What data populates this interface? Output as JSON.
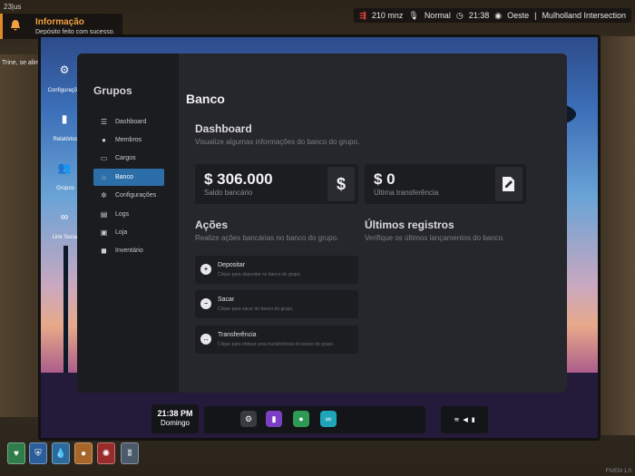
{
  "hud": {
    "player_id": "23|us",
    "notification": {
      "title": "Informação",
      "message": "Depósito feito com sucesso."
    },
    "side_text": "Trine, se alimente",
    "status_bar": {
      "money": "210 mnz",
      "mode": "Normal",
      "time": "21:38",
      "direction": "Oeste",
      "location": "Mulholland Intersection"
    },
    "watermark": "FIVEM 1.0"
  },
  "home_icons": [
    {
      "label": "Configurações",
      "icon": "gear-icon",
      "color": "#3a3b40"
    },
    {
      "label": "Relatórios",
      "icon": "chart-icon",
      "color": "#7b3fc4"
    },
    {
      "label": "Grupos",
      "icon": "people-icon",
      "color": "#2f9a55"
    },
    {
      "label": "Link Social",
      "icon": "link-icon",
      "color": "#1fa5b8"
    }
  ],
  "app": {
    "sidebar_title": "Grupos",
    "nav": [
      {
        "label": "Dashboard",
        "icon": "list-icon"
      },
      {
        "label": "Membros",
        "icon": "users-icon"
      },
      {
        "label": "Cargos",
        "icon": "truck-icon"
      },
      {
        "label": "Banco",
        "icon": "bank-icon",
        "active": true
      },
      {
        "label": "Configurações",
        "icon": "gears-icon"
      },
      {
        "label": "Logs",
        "icon": "document-icon"
      },
      {
        "label": "Loja",
        "icon": "basket-icon"
      },
      {
        "label": "Inventário",
        "icon": "box-icon"
      }
    ],
    "page_title": "Banco",
    "dashboard": {
      "title": "Dashboard",
      "subtitle": "Visualize algumas informações do banco do grupo.",
      "balance": {
        "value": "$ 306.000",
        "label": "Saldo bancário",
        "icon": "dollar-icon"
      },
      "last_transfer": {
        "value": "$ 0",
        "label": "Última transferência",
        "icon": "edit-document-icon"
      }
    },
    "actions": {
      "title": "Ações",
      "subtitle": "Realize ações bancárias no banco do grupo.",
      "items": [
        {
          "name": "Depositar",
          "desc": "Clique para depositar no banco do grupo."
        },
        {
          "name": "Sacar",
          "desc": "Clique para sacar do banco do grupo."
        },
        {
          "name": "Transferência",
          "desc": "Clique para efetuar uma transferência do banco do grupo."
        }
      ]
    },
    "records": {
      "title": "Últimos registros",
      "subtitle": "Verifique os últimos lançamentos do banco."
    }
  },
  "dock": {
    "time": "21:38 PM",
    "day": "Domingo",
    "apps": [
      {
        "icon": "gear-icon",
        "color": "#3a3b40"
      },
      {
        "icon": "chart-icon",
        "color": "#7b3fc4"
      },
      {
        "icon": "people-icon",
        "color": "#2f9a55"
      },
      {
        "icon": "link-icon",
        "color": "#1fa5b8"
      }
    ]
  },
  "vitals": [
    {
      "icon": "health-icon",
      "color": "#2e7d4a"
    },
    {
      "icon": "armor-icon",
      "color": "#2b5e9a"
    },
    {
      "icon": "water-icon",
      "color": "#2b6a9a"
    },
    {
      "icon": "food-icon",
      "color": "#a8652a"
    },
    {
      "icon": "stress-icon",
      "color": "#9a2b2b"
    },
    {
      "icon": "lungs-icon",
      "color": "#4a5a6a"
    }
  ]
}
